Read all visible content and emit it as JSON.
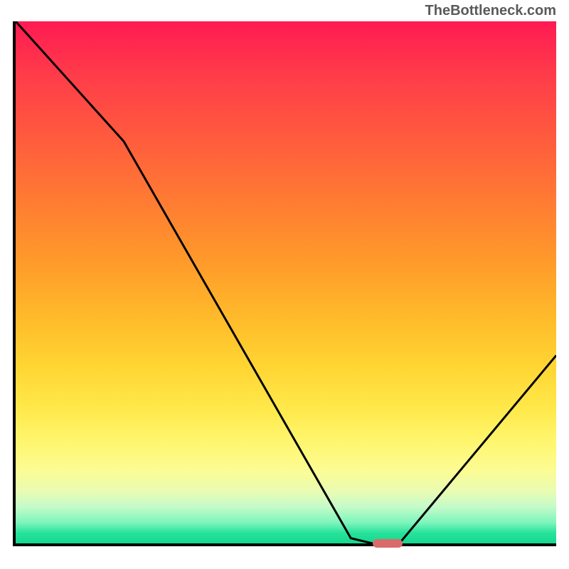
{
  "watermark": "TheBottleneck.com",
  "chart_data": {
    "type": "line",
    "title": "",
    "xlabel": "",
    "ylabel": "",
    "xlim": [
      0,
      100
    ],
    "ylim": [
      0,
      100
    ],
    "grid": false,
    "series": [
      {
        "name": "curve",
        "x": [
          0,
          20,
          62,
          66,
          71,
          100
        ],
        "values": [
          100,
          77,
          1,
          0,
          0,
          36
        ]
      }
    ],
    "marker": {
      "x_start": 66,
      "x_end": 71,
      "y": 0
    },
    "background": "heat-gradient-vertical",
    "annotations": []
  },
  "colors": {
    "curve": "#000000",
    "marker": "#d96b6b",
    "axis": "#000000"
  }
}
